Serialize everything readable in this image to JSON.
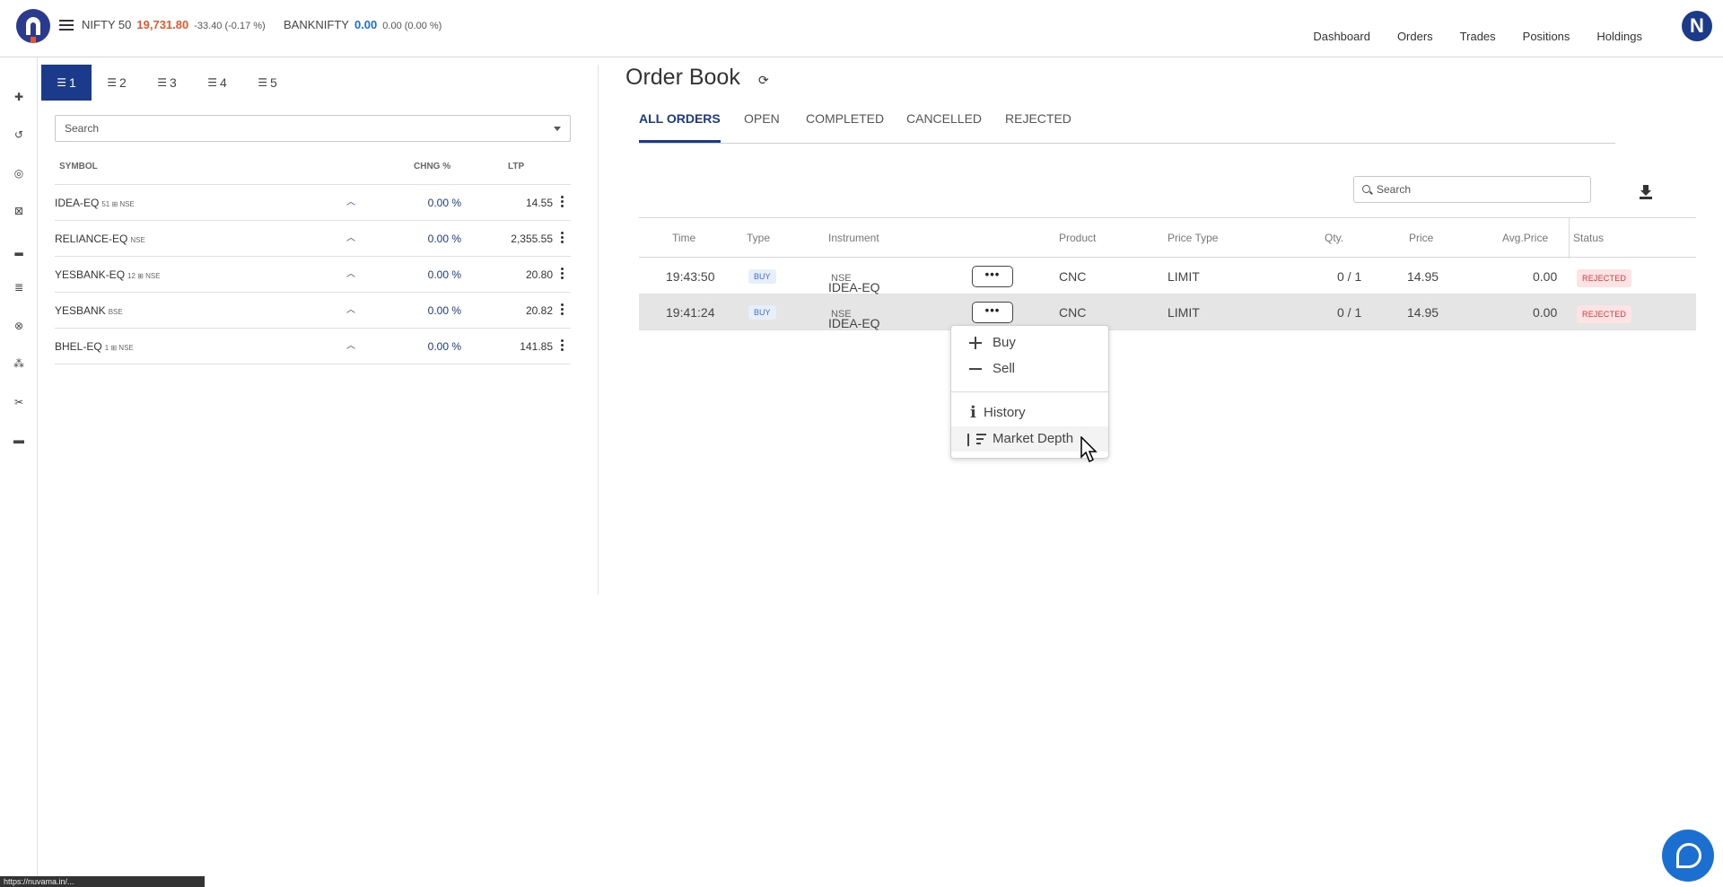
{
  "header": {
    "tickers": [
      {
        "name": "NIFTY 50",
        "value": "19,731.80",
        "change": "-33.40 (-0.17 %)",
        "value_color": "#e8562a"
      },
      {
        "name": "BANKNIFTY",
        "value": "0.00",
        "change": "0.00 (0.00 %)",
        "value_color": "#1b6fd1"
      }
    ],
    "nav": [
      "Dashboard",
      "Orders",
      "Trades",
      "Positions",
      "Holdings"
    ],
    "avatar_letter": "N"
  },
  "watchlist": {
    "tabs": [
      "1",
      "2",
      "3",
      "4",
      "5"
    ],
    "search_placeholder": "Search",
    "columns": {
      "symbol": "SYMBOL",
      "chng": "CHNG %",
      "ltp": "LTP"
    },
    "rows": [
      {
        "symbol": "IDEA-EQ",
        "meta": "51 ⊞ NSE",
        "chng": "0.00 %",
        "ltp": "14.55"
      },
      {
        "symbol": "RELIANCE-EQ",
        "meta": "NSE",
        "chng": "0.00 %",
        "ltp": "2,355.55"
      },
      {
        "symbol": "YESBANK-EQ",
        "meta": "12 ⊞ NSE",
        "chng": "0.00 %",
        "ltp": "20.80"
      },
      {
        "symbol": "YESBANK",
        "meta": "BSE",
        "chng": "0.00 %",
        "ltp": "20.82"
      },
      {
        "symbol": "BHEL-EQ",
        "meta": "1 ⊞ NSE",
        "chng": "0.00 %",
        "ltp": "141.85"
      }
    ]
  },
  "orderbook": {
    "title": "Order Book",
    "tabs": [
      "ALL ORDERS",
      "OPEN",
      "COMPLETED",
      "CANCELLED",
      "REJECTED"
    ],
    "search_placeholder": "Search",
    "columns": {
      "time": "Time",
      "type": "Type",
      "instrument": "Instrument",
      "product": "Product",
      "price_type": "Price Type",
      "qty": "Qty.",
      "price": "Price",
      "avg_price": "Avg.Price",
      "status": "Status"
    },
    "rows": [
      {
        "time": "19:43:50",
        "type": "BUY",
        "instrument": "IDEA-EQ",
        "exchange": "NSE",
        "more": "•••",
        "product": "CNC",
        "price_type": "LIMIT",
        "qty": "0 / 1",
        "price": "14.95",
        "avg_price": "0.00",
        "status": "REJECTED"
      },
      {
        "time": "19:41:24",
        "type": "BUY",
        "instrument": "IDEA-EQ",
        "exchange": "NSE",
        "more": "•••",
        "product": "CNC",
        "price_type": "LIMIT",
        "qty": "0 / 1",
        "price": "14.95",
        "avg_price": "0.00",
        "status": "REJECTED"
      }
    ]
  },
  "menu": {
    "buy": "Buy",
    "sell": "Sell",
    "history": "History",
    "market_depth": "Market Depth"
  },
  "statusbar": {
    "url": "https://nuvama.in/..."
  }
}
